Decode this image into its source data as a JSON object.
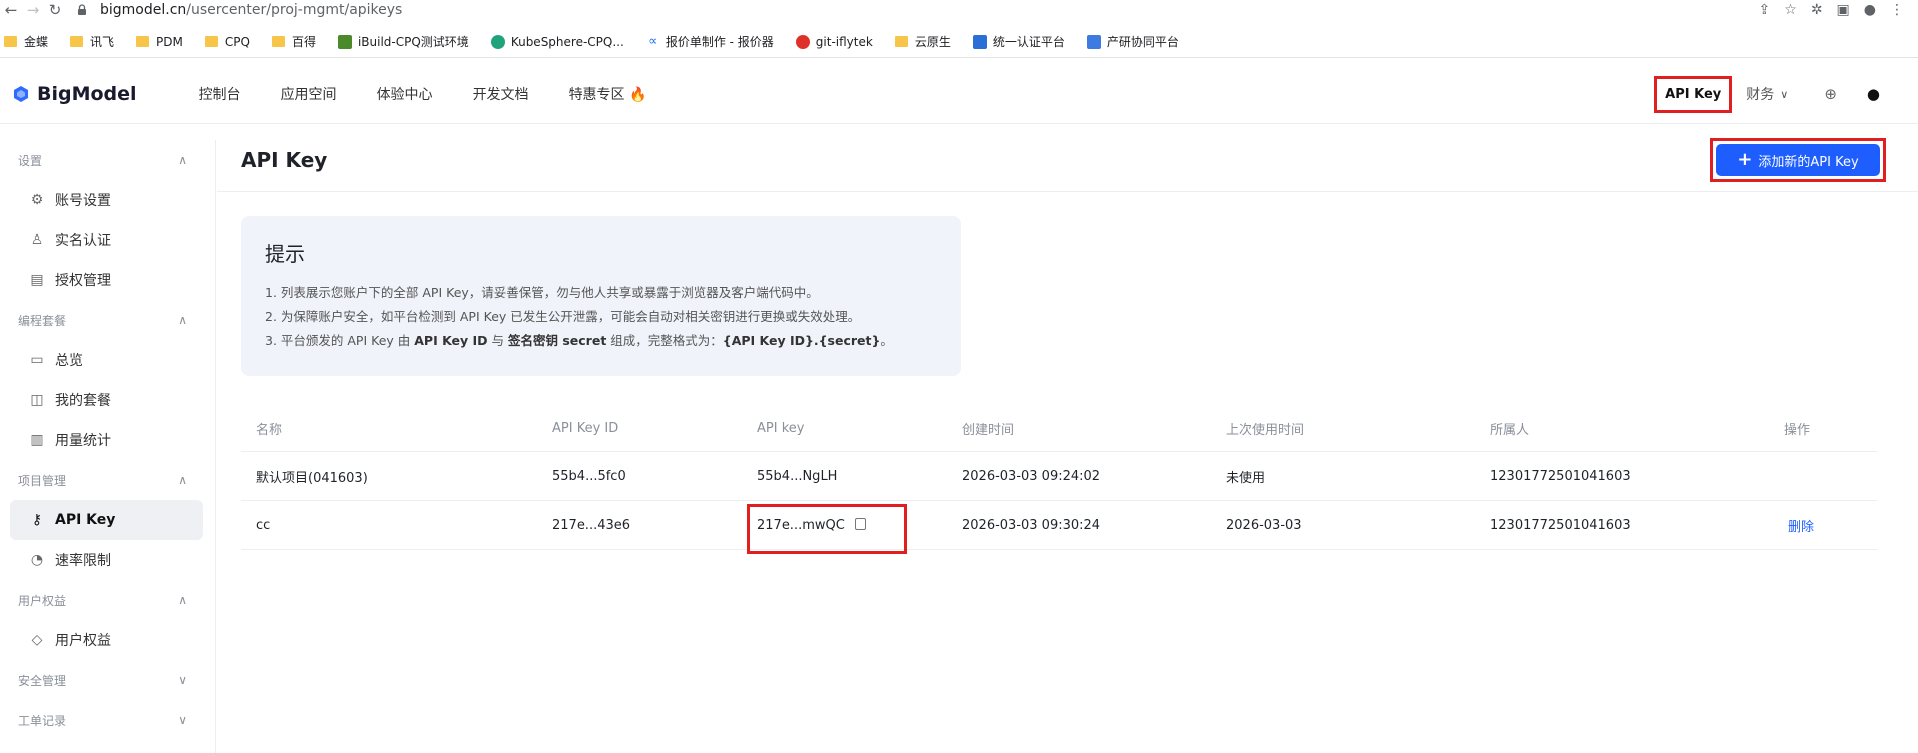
{
  "browser": {
    "url_host": "bigmodel.cn",
    "url_path": "/usercenter/proj-mgmt/apikeys",
    "bookmarks": [
      "金蝶",
      "讯飞",
      "PDM",
      "CPQ",
      "百得",
      "iBuild-CPQ测试环境",
      "KubeSphere-CPQ...",
      "报价单制作 - 报价器",
      "git-iflytek",
      "云原生",
      "统一认证平台",
      "产研协同平台"
    ]
  },
  "header": {
    "logo": "BigModel",
    "nav": [
      "控制台",
      "应用空间",
      "体验中心",
      "开发文档",
      "特惠专区"
    ],
    "apikey_label": "API Key",
    "finance_label": "财务"
  },
  "sidebar": {
    "groups": [
      {
        "title": "设置",
        "items": [
          "账号设置",
          "实名认证",
          "授权管理"
        ]
      },
      {
        "title": "编程套餐",
        "items": [
          "总览",
          "我的套餐",
          "用量统计"
        ]
      },
      {
        "title": "项目管理",
        "items": [
          "API Key",
          "速率限制"
        ]
      },
      {
        "title": "用户权益",
        "items": [
          "用户权益"
        ]
      },
      {
        "title": "安全管理",
        "items": []
      },
      {
        "title": "工单记录",
        "items": []
      }
    ]
  },
  "main": {
    "title": "API Key",
    "add_button": "添加新的API Key",
    "tip": {
      "title": "提示",
      "line1": "1. 列表展示您账户下的全部 API Key，请妥善保管，勿与他人共享或暴露于浏览器及客户端代码中。",
      "line2": "2. 为保障账户安全，如平台检测到 API Key 已发生公开泄露，可能会自动对相关密钥进行更换或失效处理。",
      "line3_a": "3. 平台颁发的 API Key 由 ",
      "line3_b": "API Key ID",
      "line3_c": " 与 ",
      "line3_d": "签名密钥 secret",
      "line3_e": " 组成，完整格式为：",
      "line3_f": "{API Key ID}.{secret}",
      "line3_g": "。"
    },
    "table": {
      "headers": [
        "名称",
        "API Key ID",
        "API key",
        "创建时间",
        "上次使用时间",
        "所属人",
        "操作"
      ],
      "rows": [
        {
          "name": "默认项目(041603)",
          "key_id": "55b4...5fc0",
          "api_key": "55b4...NgLH",
          "created": "2026-03-03 09:24:02",
          "last_used": "未使用",
          "owner": "12301772501041603",
          "action": ""
        },
        {
          "name": "cc",
          "key_id": "217e...43e6",
          "api_key": "217e...mwQC",
          "created": "2026-03-03 09:30:24",
          "last_used": "2026-03-03",
          "owner": "12301772501041603",
          "action": "删除"
        }
      ]
    }
  }
}
